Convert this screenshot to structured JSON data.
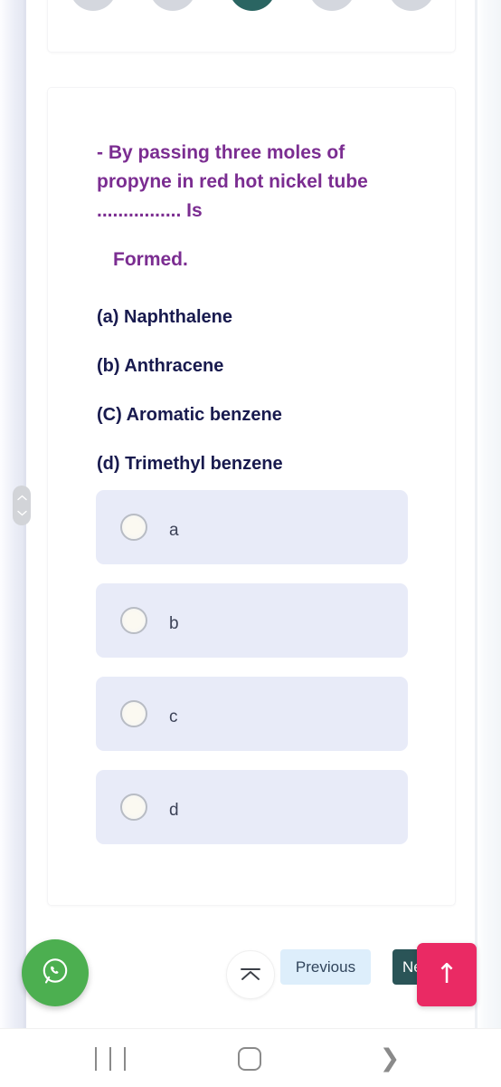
{
  "stepper": {
    "name": "question-progress-dots",
    "total": 5,
    "active_index": 2,
    "active_color": "#2a6562",
    "inactive_color": "#d4d7de"
  },
  "question": {
    "accent_color": "#7b2d91",
    "line1": "- By passing three moles of",
    "line2": "propyne in red hot nickel tube",
    "line3": "................ Is",
    "line4": "Formed.",
    "options_color": "#181a4e",
    "options": [
      "(a) Naphthalene",
      "(b) Anthracene",
      "(C) Aromatic benzene",
      "(d) Trimethyl benzene"
    ]
  },
  "answers": {
    "card_background": "#e8ebf8",
    "selected": null,
    "choices": [
      {
        "value": "a",
        "label": "a",
        "checked": false
      },
      {
        "value": "b",
        "label": "b",
        "checked": false
      },
      {
        "value": "c",
        "label": "c",
        "checked": false
      },
      {
        "value": "d",
        "label": "d",
        "checked": false
      }
    ]
  },
  "bottom_bar": {
    "whatsapp_icon": "whatsapp-icon",
    "whatsapp_color": "#4caf50",
    "scroll_top_icon": "collapse-up-icon",
    "previous_label": "Previous",
    "previous_color": "#ddeefb",
    "next_label": "Next",
    "next_color": "#2a5457",
    "scroll_up_icon": "arrow-up-icon",
    "scroll_up_glyph": "↑",
    "scroll_up_color": "#ea2a64"
  },
  "navbar": {
    "recents_icon": "recents-icon",
    "home_icon": "home-icon",
    "back_icon": "chevron-right-icon",
    "back_glyph": "❯"
  }
}
